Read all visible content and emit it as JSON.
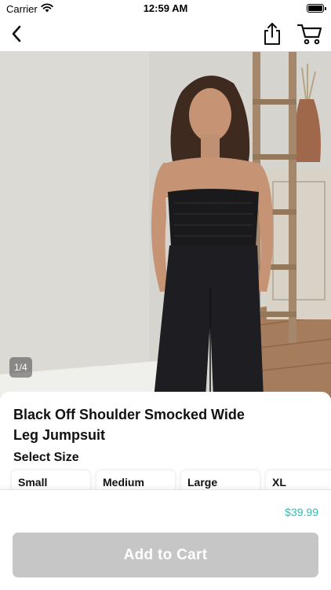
{
  "status_bar": {
    "carrier": "Carrier",
    "time": "12:59 AM",
    "icons": [
      "wifi-icon",
      "battery-icon"
    ]
  },
  "nav": {
    "icons": [
      "back-chevron-icon",
      "share-icon",
      "cart-icon"
    ]
  },
  "gallery": {
    "page_indicator": "1/4"
  },
  "product": {
    "title": "Black Off Shoulder Smocked Wide Leg Jumpsuit",
    "size_heading": "Select Size",
    "sizes": [
      "Small",
      "Medium",
      "Large",
      "XL"
    ]
  },
  "footer": {
    "price": "$39.99",
    "add_to_cart_label": "Add to Cart"
  },
  "colors": {
    "price": "#2cc1b0",
    "button_disabled": "#c6c6c6"
  }
}
